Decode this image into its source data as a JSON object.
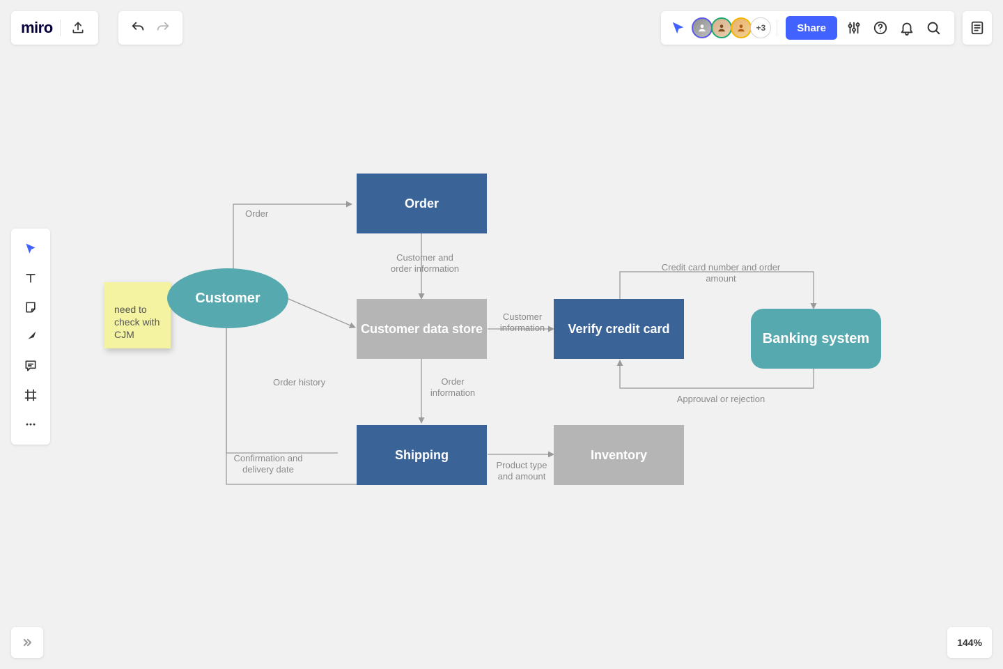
{
  "app": {
    "logo_text": "miro"
  },
  "header": {
    "share_label": "Share",
    "more_avatars": "+3"
  },
  "toolbar": {
    "tools": [
      "select",
      "text",
      "sticky",
      "arrow",
      "comment",
      "frame",
      "more"
    ]
  },
  "zoom": {
    "label": "144%"
  },
  "sticky": {
    "text": "need to check with CJM"
  },
  "nodes": {
    "customer": "Customer",
    "order": "Order",
    "customer_data_store": "Customer data store",
    "verify_credit_card": "Verify credit card",
    "banking_system": "Banking system",
    "shipping": "Shipping",
    "inventory": "Inventory"
  },
  "edges": {
    "e1": "Order",
    "e2": "Customer and order information",
    "e3": "Customer information",
    "e4": "Credit card number and order amount",
    "e5": "Approuval or rejection",
    "e6": "Order information",
    "e7": "Order history",
    "e8": "Confirmation and delivery date",
    "e9": "Product type and amount"
  }
}
